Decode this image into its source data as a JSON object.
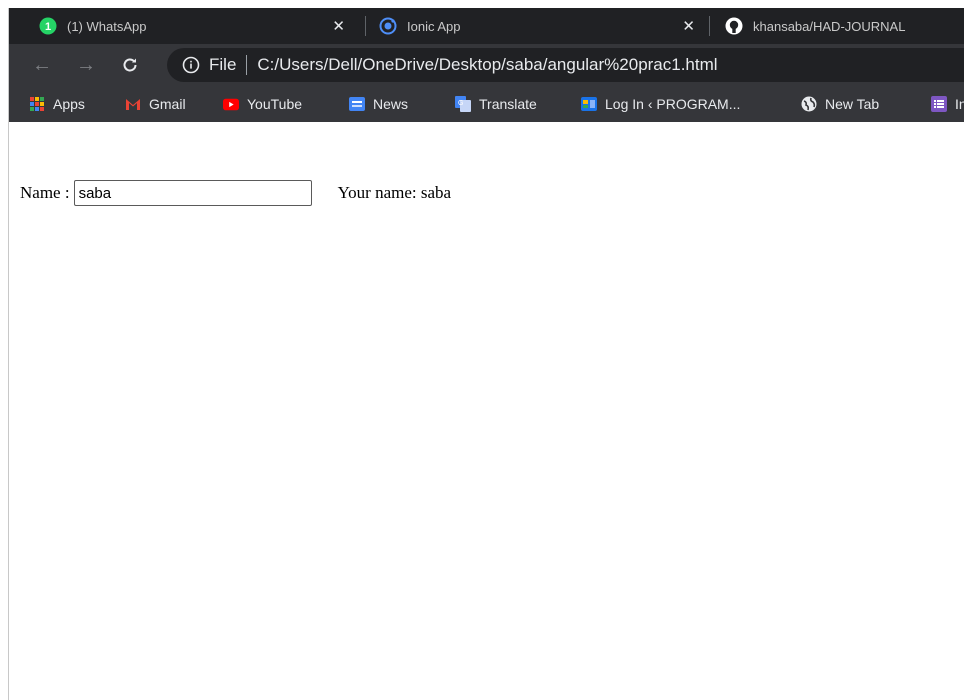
{
  "tabs": [
    {
      "title": "(1) WhatsApp",
      "icon": "whatsapp-icon",
      "close": "✕"
    },
    {
      "title": "Ionic App",
      "icon": "ionic-icon",
      "close": "✕"
    },
    {
      "title": "khansaba/HAD-JOURNAL",
      "icon": "github-icon"
    }
  ],
  "whatsapp_badge": "1",
  "address": {
    "file_label": "File",
    "url": "C:/Users/Dell/OneDrive/Desktop/saba/angular%20prac1.html"
  },
  "bookmarks": [
    {
      "label": "Apps",
      "icon": "apps-grid-icon"
    },
    {
      "label": "Gmail",
      "icon": "gmail-icon"
    },
    {
      "label": "YouTube",
      "icon": "youtube-icon"
    },
    {
      "label": "News",
      "icon": "news-icon"
    },
    {
      "label": "Translate",
      "icon": "translate-icon"
    },
    {
      "label": "Log In ‹ PROGRAM...",
      "icon": "site-icon"
    },
    {
      "label": "New Tab",
      "icon": "globe-icon"
    },
    {
      "label": "In",
      "icon": "list-icon"
    }
  ],
  "form": {
    "name_label": "Name :",
    "name_value": "saba",
    "echo_text": "Your name: saba"
  },
  "colors": {
    "whatsapp": "#25d366",
    "ionic": "#4e8ef7",
    "gmail_red": "#ea4335",
    "youtube_red": "#ff0000",
    "news_blue": "#4285f4"
  }
}
